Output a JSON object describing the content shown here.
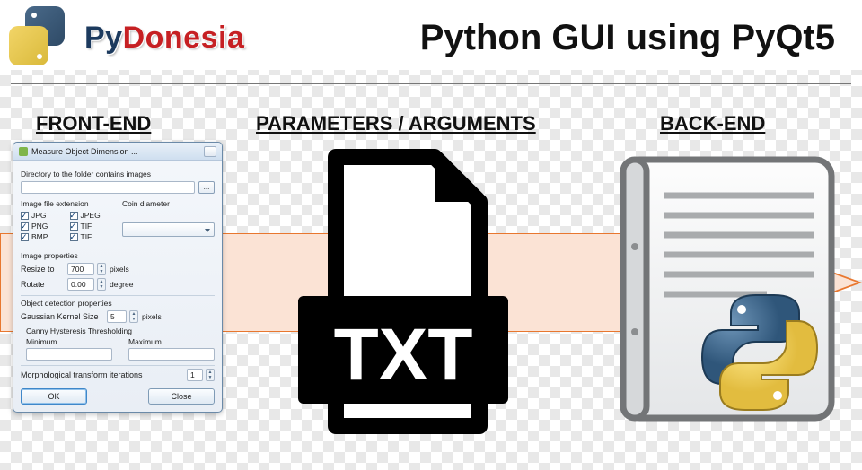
{
  "brand": {
    "py": "Py",
    "rest": "Donesia"
  },
  "title": "Python GUI using PyQt5",
  "sections": {
    "front": "FRONT-END",
    "params": "PARAMETERS / ARGUMENTS",
    "back": "BACK-END"
  },
  "txt_label": "TXT",
  "dialog": {
    "title": "Measure Object Dimension ...",
    "dir_label": "Directory to the folder contains images",
    "browse": "...",
    "ext_label": "Image file extension",
    "exts": [
      "JPG",
      "JPEG",
      "PNG",
      "TIF",
      "BMP",
      "TIF"
    ],
    "coin_label": "Coin diameter",
    "props_label": "Image properties",
    "resize_label": "Resize to",
    "resize_val": "700",
    "resize_unit": "pixels",
    "rotate_label": "Rotate",
    "rotate_val": "0.00",
    "rotate_unit": "degree",
    "obj_label": "Object detection properties",
    "gk_label": "Gaussian Kernel Size",
    "gk_val": "5",
    "gk_unit": "pixels",
    "canny_label": "Canny Hysteresis Thresholding",
    "min_label": "Minimum",
    "max_label": "Maximum",
    "morph_label": "Morphological transform iterations",
    "morph_val": "1",
    "ok": "OK",
    "close": "Close"
  }
}
